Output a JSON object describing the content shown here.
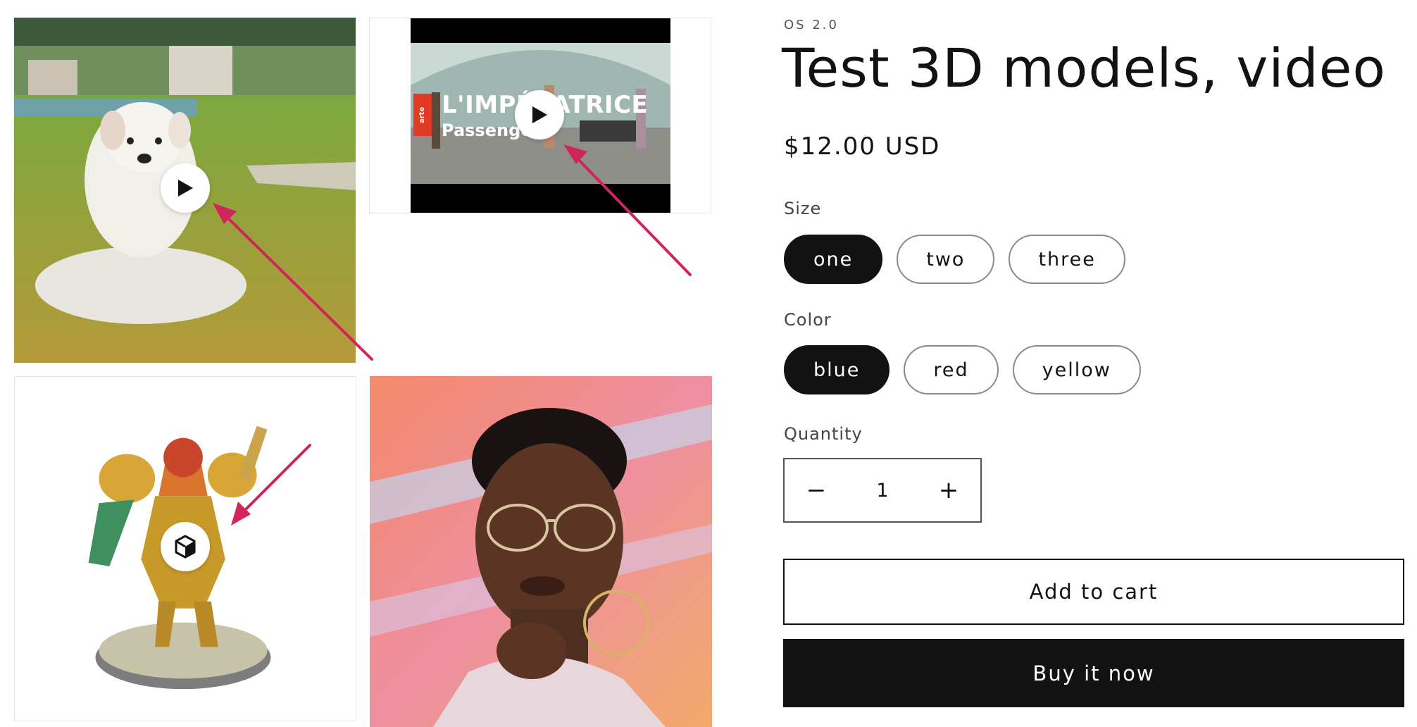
{
  "gallery": {
    "video_title": "L'IMPÉRATRICE",
    "video_subtitle": "Passenger",
    "video_brand": "arte",
    "items": [
      {
        "kind": "video",
        "icon": "play-icon"
      },
      {
        "kind": "external-video",
        "icon": "play-icon"
      },
      {
        "kind": "3d-model",
        "icon": "cube-icon"
      },
      {
        "kind": "image"
      }
    ],
    "annotation_color": "#d0255a"
  },
  "product": {
    "vendor": "OS 2.0",
    "title": "Test 3D models, video",
    "price": "$12.00 USD",
    "size": {
      "label": "Size",
      "options": [
        "one",
        "two",
        "three"
      ],
      "selected": "one"
    },
    "color": {
      "label": "Color",
      "options": [
        "blue",
        "red",
        "yellow"
      ],
      "selected": "blue"
    },
    "quantity": {
      "label": "Quantity",
      "value": "1",
      "decrease": "−",
      "increase": "+"
    },
    "add_to_cart": "Add to cart",
    "buy_now": "Buy it now"
  }
}
